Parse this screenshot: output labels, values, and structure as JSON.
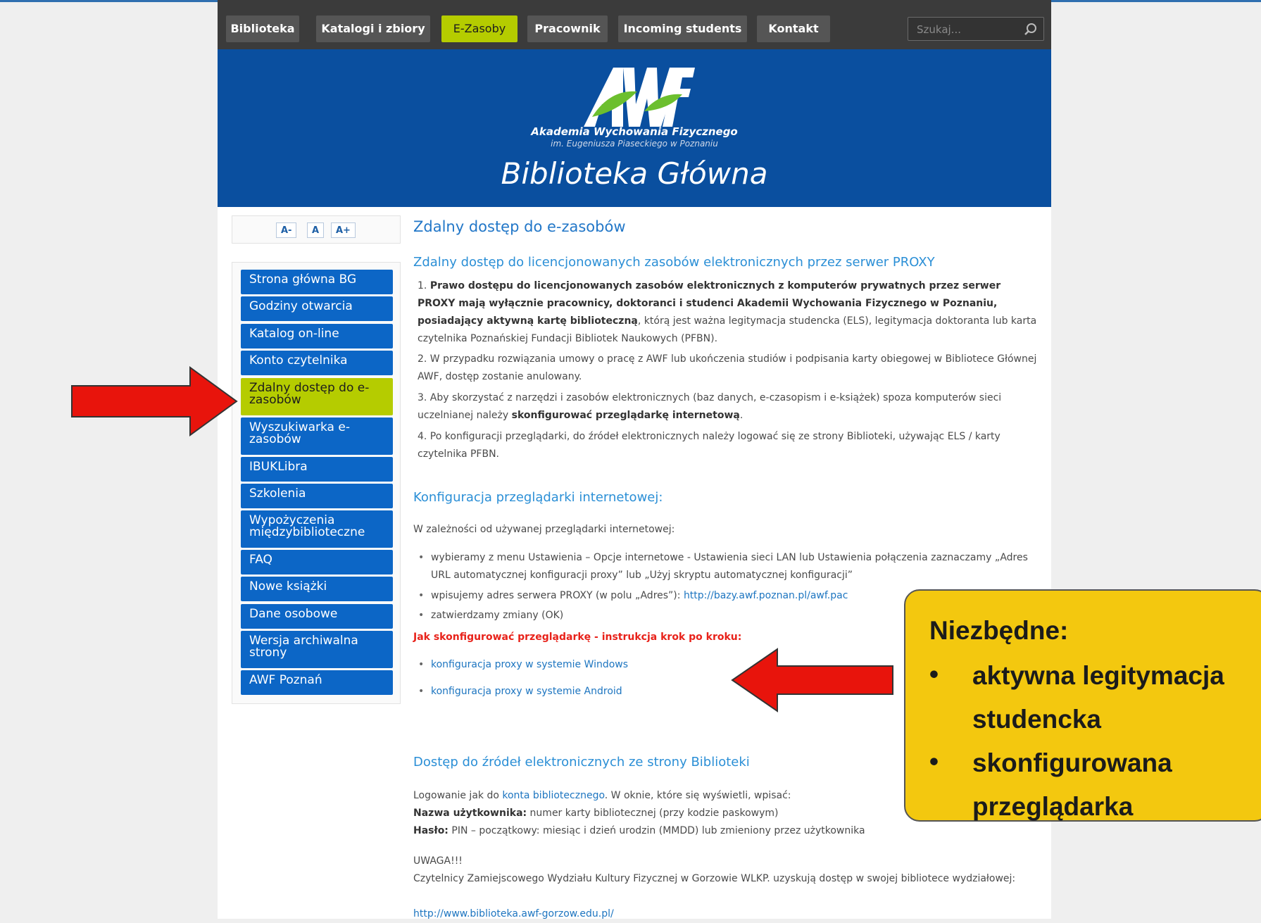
{
  "nav": {
    "items": [
      "Biblioteka",
      "Katalogi i zbiory",
      "E-Zasoby",
      "Pracownik",
      "Incoming students",
      "Kontakt"
    ],
    "search_placeholder": "Szukaj..."
  },
  "banner": {
    "logo_text": "AWF",
    "line1": "Akademia Wychowania Fizycznego",
    "line2": "im. Eugeniusza Piaseckiego w Poznaniu",
    "title": "Biblioteka Główna"
  },
  "font_controls": [
    "A-",
    "A",
    "A+"
  ],
  "sidebar": {
    "items": [
      "Strona główna BG",
      "Godziny otwarcia",
      "Katalog on-line",
      "Konto czytelnika",
      "Zdalny dostęp do e-zasobów",
      "Wyszukiwarka e-zasobów",
      "IBUKLibra",
      "Szkolenia",
      "Wypożyczenia międzybiblioteczne",
      "FAQ",
      "Nowe książki",
      "Dane osobowe",
      "Wersja archiwalna strony",
      "AWF Poznań"
    ],
    "active_index": 4
  },
  "main": {
    "title": "Zdalny dostęp do e-zasobów",
    "section1_title": "Zdalny dostęp do licencjonowanych zasobów elektronicznych przez serwer PROXY",
    "p1_num": "1. ",
    "p1_bold": "Prawo dostępu do licencjonowanych zasobów elektronicznych z komputerów prywatnych przez serwer PROXY mają wyłącznie pracownicy, doktoranci i studenci Akademii Wychowania Fizycznego w Poznaniu, posiadający aktywną kartę biblioteczną",
    "p1_rest": ", którą jest ważna legitymacja studencka (ELS), legitymacja doktoranta lub karta czytelnika Poznańskiej Fundacji Bibliotek Naukowych (PFBN).",
    "p2": "2. W przypadku rozwiązania umowy o pracę z AWF lub ukończenia studiów i podpisania karty obiegowej w Bibliotece Głównej AWF, dostęp zostanie anulowany.",
    "p3_text": "3. Aby skorzystać z narzędzi i zasobów elektronicznych (baz danych, e-czasopism i e-książek) spoza komputerów sieci uczelnianej należy ",
    "p3_bold": "skonfigurować przeglądarkę internetową",
    "p3_end": ".",
    "p4": "4. Po konfiguracji przeglądarki, do źródeł elektronicznych należy logować się ze strony Biblioteki, używając ELS / karty czytelnika PFBN.",
    "section2_title": "Konfiguracja przeglądarki internetowej:",
    "section2_intro": "W zależności od używanej przeglądarki internetowej:",
    "bullet1": "wybieramy z menu Ustawienia – Opcje internetowe - Ustawienia sieci LAN lub Ustawienia połączenia zaznaczamy „Adres URL automatycznej konfiguracji proxy” lub „Użyj skryptu automatycznej konfiguracji”",
    "bullet2_text": "wpisujemy adres serwera PROXY (w polu „Adres”): ",
    "bullet2_link": "http://bazy.awf.poznan.pl/awf.pac",
    "bullet3": "zatwierdzamy zmiany (OK)",
    "howto": "Jak skonfigurować przeglądarkę - instrukcja krok po kroku:",
    "link_windows": "konfiguracja proxy w systemie Windows",
    "link_android": "konfiguracja proxy w systemie Android",
    "section3_title": "Dostęp do źródeł elektronicznych ze strony Biblioteki",
    "login_text": "Logowanie jak do ",
    "login_link": "konta bibliotecznego",
    "login_rest": ". W oknie, które się wyświetli, wpisać:",
    "user_label": "Nazwa użytkownika:",
    "user_text": " numer karty bibliotecznej (przy kodzie paskowym)",
    "pass_label": "Hasło:",
    "pass_text": " PIN – początkowy: miesiąc i dzień urodzin (MMDD) lub zmieniony przez użytkownika",
    "warning": "UWAGA!!!",
    "warning_text": "Czytelnicy Zamiejscowego Wydziału Kultury Fizycznej w Gorzowie WLKP. uzyskują dostęp w swojej bibliotece wydziałowej:",
    "gorzow_link": "http://www.biblioteka.awf-gorzow.edu.pl/"
  },
  "callout": {
    "title": "Niezbędne:",
    "item1": "aktywna legitymacja studencka",
    "item2": "skonfigurowana przeglądarka"
  },
  "colors": {
    "nav_active": "#b5cc00",
    "menu_blue": "#0c66c6",
    "banner": "#0a4f9f",
    "callout": "#f3c80f",
    "arrow": "#e8140c"
  }
}
